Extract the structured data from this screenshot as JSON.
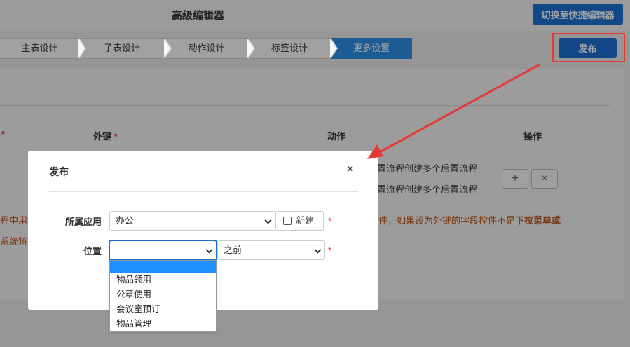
{
  "header": {
    "title": "高级编辑器",
    "switch_label": "切换至快捷编辑器"
  },
  "steps": [
    {
      "label": "主表设计",
      "active": false
    },
    {
      "label": "子表设计",
      "active": false
    },
    {
      "label": "动作设计",
      "active": false
    },
    {
      "label": "标签设计",
      "active": false
    },
    {
      "label": "更多设置",
      "active": true
    }
  ],
  "publish_label": "发布",
  "table": {
    "col_foreign_key": "外键",
    "col_action": "动作",
    "col_operation": "操作",
    "action_row1": "置流程创建多个后置流程",
    "action_row2": "置流程创建多个后置流程",
    "add_symbol": "+",
    "remove_symbol": "×"
  },
  "notes": {
    "left_line1": "程中用来",
    "left_line2": "系统将默",
    "right_prefix": "件，如果设为外键的字段控件不是",
    "right_bold": "下拉菜单或"
  },
  "modal": {
    "title": "发布",
    "close_symbol": "×",
    "app_label": "所属应用",
    "app_value": "办公",
    "new_label": "新建",
    "position_label": "位置",
    "position_value": "",
    "order_value": "之前",
    "required_mark": "*"
  },
  "dropdown": {
    "options": [
      "",
      "物品领用",
      "公章使用",
      "会议室预订",
      "物品管理"
    ]
  },
  "colors": {
    "primary": "#1e6fd0",
    "step_active": "#2d8ee0",
    "highlight": "#e53935",
    "warning_text": "#b8561e"
  }
}
